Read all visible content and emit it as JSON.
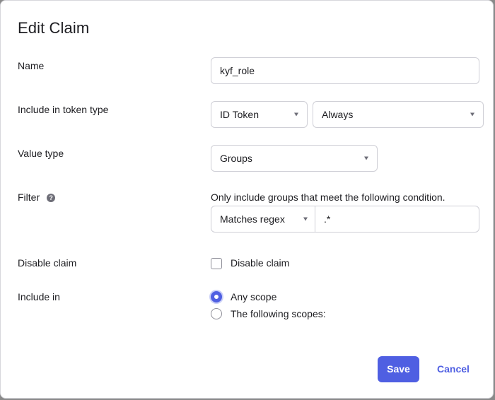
{
  "dialog": {
    "title": "Edit Claim"
  },
  "fields": {
    "name": {
      "label": "Name",
      "value": "kyf_role"
    },
    "token_type": {
      "label": "Include in token type",
      "token_value": "ID Token",
      "when_value": "Always"
    },
    "value_type": {
      "label": "Value type",
      "value": "Groups"
    },
    "filter": {
      "label": "Filter",
      "help_glyph": "?",
      "hint": "Only include groups that meet the following condition.",
      "operator_value": "Matches regex",
      "pattern_value": ".*"
    },
    "disable_claim": {
      "label": "Disable claim",
      "checkbox_label": "Disable claim",
      "checked": false
    },
    "include_in": {
      "label": "Include in",
      "options": [
        {
          "label": "Any scope",
          "selected": true
        },
        {
          "label": "The following scopes:",
          "selected": false
        }
      ]
    }
  },
  "buttons": {
    "save_label": "Save",
    "cancel_label": "Cancel"
  },
  "colors": {
    "accent": "#4f5fe2"
  },
  "icons": {
    "help": "help-icon",
    "dropdown": "chevron-down-icon"
  }
}
